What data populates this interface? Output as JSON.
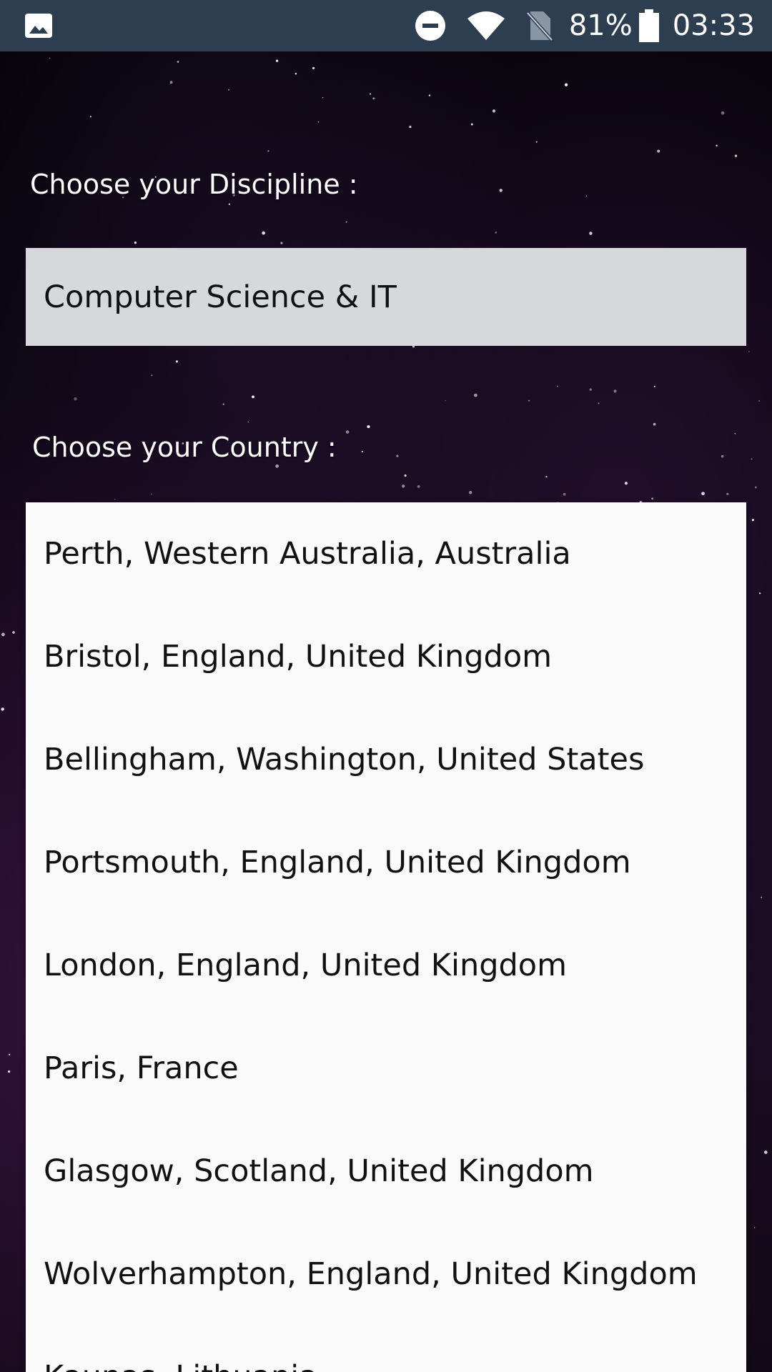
{
  "status_bar": {
    "left_icon": "image-icon",
    "icons": [
      "do-not-disturb-icon",
      "wifi-icon",
      "no-sim-icon",
      "battery-icon"
    ],
    "battery_percent": "81%",
    "time": "03:33",
    "background": "#2d3e50"
  },
  "form": {
    "discipline_label": "Choose your Discipline :",
    "discipline_value": "Computer Science & IT",
    "country_label": "Choose your Country :"
  },
  "dropdown": {
    "items": [
      {
        "label": "Perth, Western Australia, Australia"
      },
      {
        "label": "Bristol, England, United Kingdom"
      },
      {
        "label": "Bellingham, Washington, United States"
      },
      {
        "label": "Portsmouth, England, United Kingdom"
      },
      {
        "label": "London, England, United Kingdom"
      },
      {
        "label": "Paris, France"
      },
      {
        "label": "Glasgow, Scotland, United Kingdom"
      },
      {
        "label": "Wolverhampton, England, United Kingdom"
      },
      {
        "label": "Kaunas, Lithuania"
      }
    ]
  },
  "colors": {
    "spinner_bg": "#d7d8dc",
    "dropdown_bg": "#fafafa",
    "text_dark": "#111111",
    "label_text": "#ffffff"
  }
}
